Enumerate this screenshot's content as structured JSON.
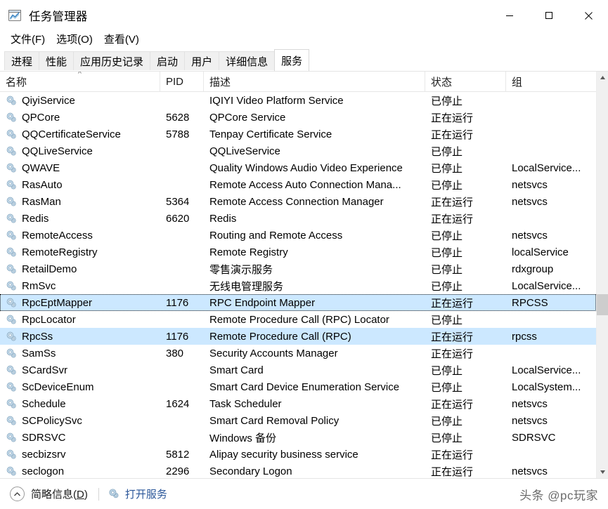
{
  "window": {
    "title": "任务管理器",
    "icon": "task-manager-icon",
    "controls": {
      "minimize": "最小化",
      "maximize": "最大化",
      "close": "关闭"
    }
  },
  "menubar": {
    "items": [
      {
        "label": "文件(F)"
      },
      {
        "label": "选项(O)"
      },
      {
        "label": "查看(V)"
      }
    ]
  },
  "tabs": {
    "selected": "服务",
    "items": [
      {
        "label": "进程",
        "selected": false
      },
      {
        "label": "性能",
        "selected": false
      },
      {
        "label": "应用历史记录",
        "selected": false
      },
      {
        "label": "启动",
        "selected": false
      },
      {
        "label": "用户",
        "selected": false
      },
      {
        "label": "详细信息",
        "selected": false
      },
      {
        "label": "服务",
        "selected": true
      }
    ]
  },
  "table": {
    "sort_column": "名称",
    "sort_direction": "ascending",
    "sort_caret": "^",
    "columns": [
      {
        "key": "name",
        "label": "名称"
      },
      {
        "key": "pid",
        "label": "PID"
      },
      {
        "key": "desc",
        "label": "描述"
      },
      {
        "key": "state",
        "label": "状态"
      },
      {
        "key": "group",
        "label": "组"
      }
    ],
    "state_running": "正在运行",
    "state_stopped": "已停止",
    "rows": [
      {
        "name": "QiyiService",
        "pid": "",
        "desc": "IQIYI Video Platform Service",
        "state": "已停止",
        "group": "",
        "selected": false,
        "focused": false
      },
      {
        "name": "QPCore",
        "pid": "5628",
        "desc": "QPCore Service",
        "state": "正在运行",
        "group": "",
        "selected": false,
        "focused": false
      },
      {
        "name": "QQCertificateService",
        "pid": "5788",
        "desc": "Tenpay Certificate Service",
        "state": "正在运行",
        "group": "",
        "selected": false,
        "focused": false
      },
      {
        "name": "QQLiveService",
        "pid": "",
        "desc": "QQLiveService",
        "state": "已停止",
        "group": "",
        "selected": false,
        "focused": false
      },
      {
        "name": "QWAVE",
        "pid": "",
        "desc": "Quality Windows Audio Video Experience",
        "state": "已停止",
        "group": "LocalService...",
        "selected": false,
        "focused": false
      },
      {
        "name": "RasAuto",
        "pid": "",
        "desc": "Remote Access Auto Connection Mana...",
        "state": "已停止",
        "group": "netsvcs",
        "selected": false,
        "focused": false
      },
      {
        "name": "RasMan",
        "pid": "5364",
        "desc": "Remote Access Connection Manager",
        "state": "正在运行",
        "group": "netsvcs",
        "selected": false,
        "focused": false
      },
      {
        "name": "Redis",
        "pid": "6620",
        "desc": "Redis",
        "state": "正在运行",
        "group": "",
        "selected": false,
        "focused": false
      },
      {
        "name": "RemoteAccess",
        "pid": "",
        "desc": "Routing and Remote Access",
        "state": "已停止",
        "group": "netsvcs",
        "selected": false,
        "focused": false
      },
      {
        "name": "RemoteRegistry",
        "pid": "",
        "desc": "Remote Registry",
        "state": "已停止",
        "group": "localService",
        "selected": false,
        "focused": false
      },
      {
        "name": "RetailDemo",
        "pid": "",
        "desc": "零售演示服务",
        "state": "已停止",
        "group": "rdxgroup",
        "selected": false,
        "focused": false
      },
      {
        "name": "RmSvc",
        "pid": "",
        "desc": "无线电管理服务",
        "state": "已停止",
        "group": "LocalService...",
        "selected": false,
        "focused": false
      },
      {
        "name": "RpcEptMapper",
        "pid": "1176",
        "desc": "RPC Endpoint Mapper",
        "state": "正在运行",
        "group": "RPCSS",
        "selected": true,
        "focused": true
      },
      {
        "name": "RpcLocator",
        "pid": "",
        "desc": "Remote Procedure Call (RPC) Locator",
        "state": "已停止",
        "group": "",
        "selected": false,
        "focused": false
      },
      {
        "name": "RpcSs",
        "pid": "1176",
        "desc": "Remote Procedure Call (RPC)",
        "state": "正在运行",
        "group": "rpcss",
        "selected": true,
        "focused": false
      },
      {
        "name": "SamSs",
        "pid": "380",
        "desc": "Security Accounts Manager",
        "state": "正在运行",
        "group": "",
        "selected": false,
        "focused": false
      },
      {
        "name": "SCardSvr",
        "pid": "",
        "desc": "Smart Card",
        "state": "已停止",
        "group": "LocalService...",
        "selected": false,
        "focused": false
      },
      {
        "name": "ScDeviceEnum",
        "pid": "",
        "desc": "Smart Card Device Enumeration Service",
        "state": "已停止",
        "group": "LocalSystem...",
        "selected": false,
        "focused": false
      },
      {
        "name": "Schedule",
        "pid": "1624",
        "desc": "Task Scheduler",
        "state": "正在运行",
        "group": "netsvcs",
        "selected": false,
        "focused": false
      },
      {
        "name": "SCPolicySvc",
        "pid": "",
        "desc": "Smart Card Removal Policy",
        "state": "已停止",
        "group": "netsvcs",
        "selected": false,
        "focused": false
      },
      {
        "name": "SDRSVC",
        "pid": "",
        "desc": "Windows 备份",
        "state": "已停止",
        "group": "SDRSVC",
        "selected": false,
        "focused": false
      },
      {
        "name": "secbizsrv",
        "pid": "5812",
        "desc": "Alipay security business service",
        "state": "正在运行",
        "group": "",
        "selected": false,
        "focused": false
      },
      {
        "name": "seclogon",
        "pid": "2296",
        "desc": "Secondary Logon",
        "state": "正在运行",
        "group": "netsvcs",
        "selected": false,
        "focused": false
      }
    ]
  },
  "scrollbar": {
    "up_arrow": "▲",
    "down_arrow": "▼"
  },
  "bottombar": {
    "less_details_label": "简略信息(D)",
    "less_details_accel": "D",
    "open_services_label": "打开服务",
    "watermark": "头条 @pc玩家"
  },
  "colors": {
    "selection": "#cce8ff",
    "link": "#2a5699",
    "tab_inactive": "#f0f0f0",
    "scroll_thumb": "#cdcdcd"
  }
}
